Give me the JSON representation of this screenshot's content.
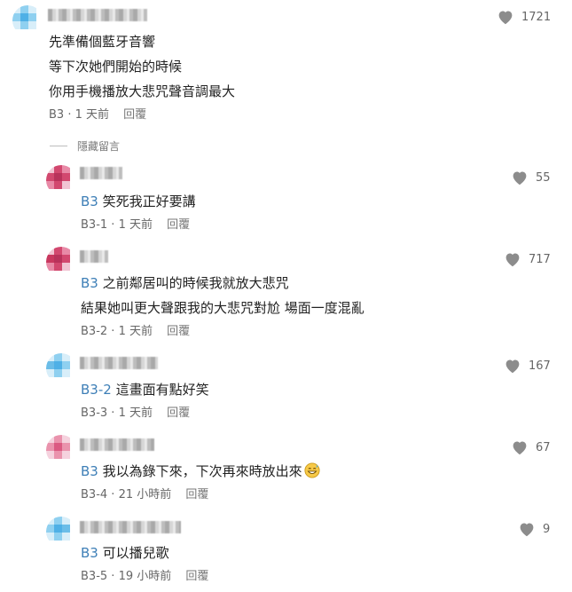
{
  "main_comment": {
    "lines": [
      "先準備個藍牙音響",
      "等下次她們開始的時候",
      "你用手機播放大悲咒聲音調最大"
    ],
    "tag": "B3",
    "time": "1 天前",
    "reply_label": "回覆",
    "likes": "1721"
  },
  "hide_label": "隱藏留言",
  "replies": [
    {
      "tag": "B3",
      "lines": [
        "笑死我正好要講"
      ],
      "floor": "B3-1",
      "time": "1 天前",
      "reply_label": "回覆",
      "likes": "55"
    },
    {
      "tag": "B3",
      "lines": [
        "之前鄰居叫的時候我就放大悲咒",
        "結果她叫更大聲跟我的大悲咒對尬 場面一度混亂"
      ],
      "floor": "B3-2",
      "time": "1 天前",
      "reply_label": "回覆",
      "likes": "717"
    },
    {
      "tag": "B3-2",
      "lines": [
        "這畫面有點好笑"
      ],
      "floor": "B3-3",
      "time": "1 天前",
      "reply_label": "回覆",
      "likes": "167"
    },
    {
      "tag": "B3",
      "lines": [
        "我以為錄下來，下次再來時放出來"
      ],
      "floor": "B3-4",
      "time": "21 小時前",
      "reply_label": "回覆",
      "likes": "67",
      "emoji": "grinning-sweat-emoji"
    },
    {
      "tag": "B3",
      "lines": [
        "可以播兒歌"
      ],
      "floor": "B3-5",
      "time": "19 小時前",
      "reply_label": "回覆",
      "likes": "9"
    }
  ],
  "colors": {
    "tag_blue": "#3e7fb7",
    "heart_gray": "#8c8c8c",
    "avatar_blue": "#6bbde8",
    "avatar_pink": "#d2486f"
  }
}
